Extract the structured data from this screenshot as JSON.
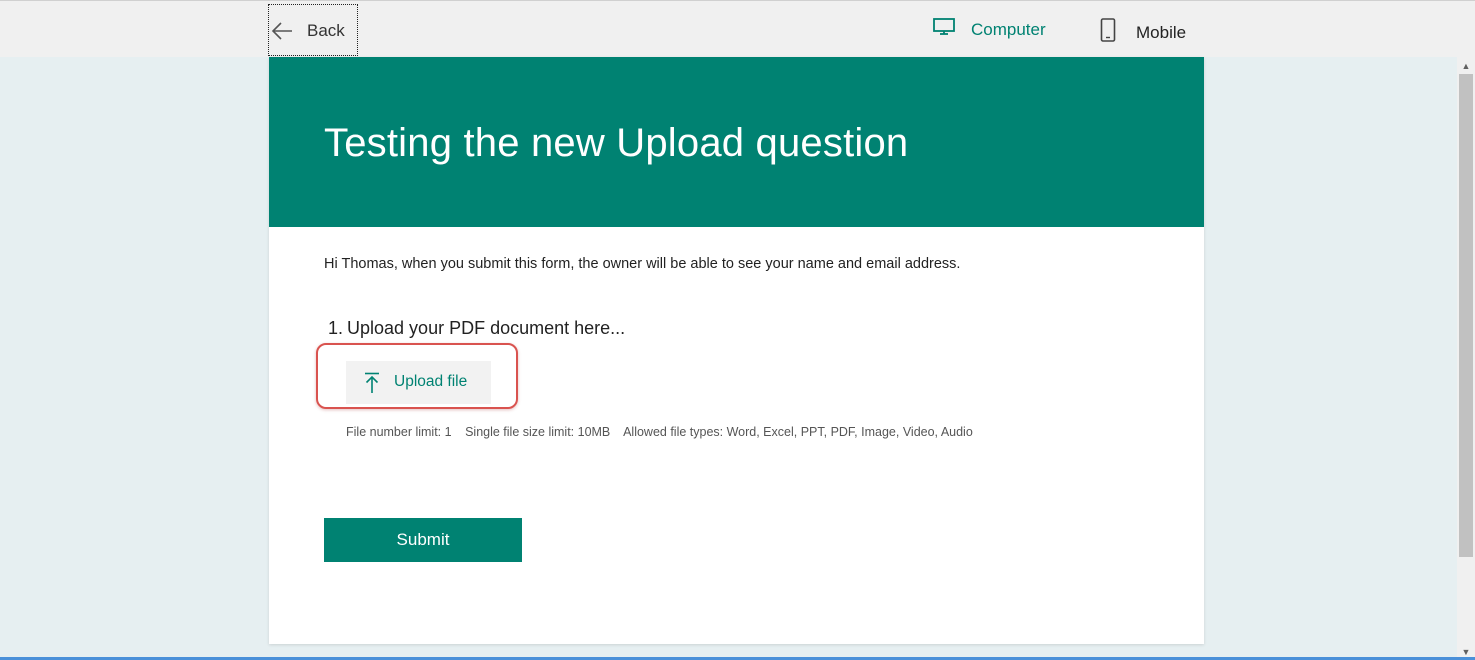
{
  "topbar": {
    "back_label": "Back",
    "computer_label": "Computer",
    "mobile_label": "Mobile"
  },
  "form": {
    "title": "Testing the new Upload question",
    "notice": "Hi Thomas, when you submit this form, the owner will be able to see your name and email address.",
    "question": {
      "number": "1.",
      "text": "Upload your PDF document here...",
      "upload_label": "Upload file",
      "limits": {
        "file_number": "File number limit: 1",
        "file_size": "Single file size limit: 10MB",
        "file_types": "Allowed file types: Word, Excel, PPT, PDF, Image, Video, Audio"
      }
    },
    "submit_label": "Submit"
  },
  "colors": {
    "accent": "#008272",
    "highlight": "#d9534f",
    "page_bg": "#e6eff1"
  },
  "icons": {
    "back": "arrow-left-icon",
    "computer": "monitor-icon",
    "mobile": "phone-icon",
    "upload": "upload-arrow-icon"
  }
}
